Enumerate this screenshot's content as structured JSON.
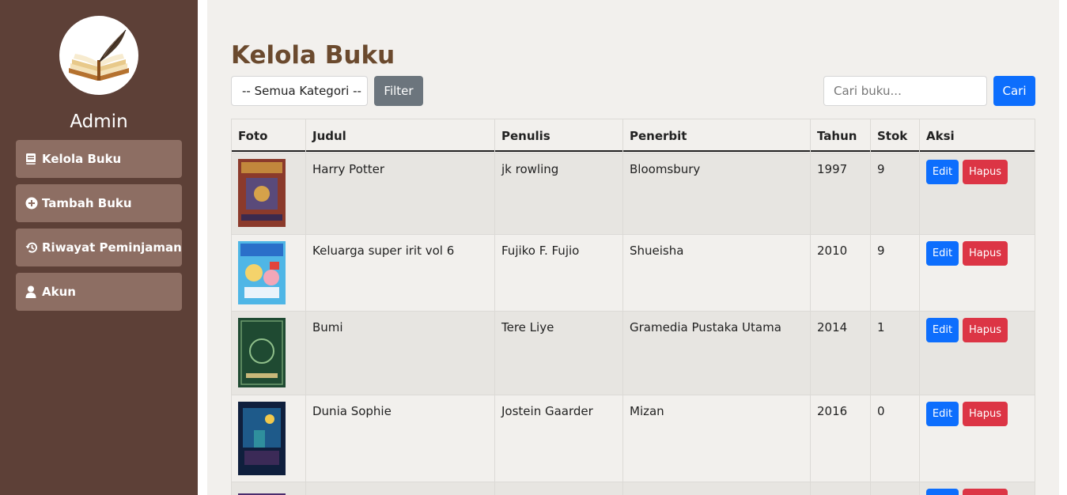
{
  "sidebar": {
    "username": "Admin",
    "items": [
      {
        "label": "Kelola Buku",
        "icon": "book-icon"
      },
      {
        "label": "Tambah Buku",
        "icon": "plus-circle-icon"
      },
      {
        "label": "Riwayat Peminjaman",
        "icon": "history-icon"
      },
      {
        "label": "Akun",
        "icon": "user-icon"
      }
    ]
  },
  "main": {
    "title": "Kelola Buku",
    "category_select": "-- Semua Kategori --",
    "filter_label": "Filter",
    "search_placeholder": "Cari buku...",
    "search_button": "Cari"
  },
  "table": {
    "headers": [
      "Foto",
      "Judul",
      "Penulis",
      "Penerbit",
      "Tahun",
      "Stok",
      "Aksi"
    ],
    "rows": [
      {
        "judul": "Harry Potter",
        "penulis": "jk rowling",
        "penerbit": "Bloomsbury",
        "tahun": "1997",
        "stok": "9"
      },
      {
        "judul": "Keluarga super irit vol 6",
        "penulis": "Fujiko F. Fujio",
        "penerbit": "Shueisha",
        "tahun": "2010",
        "stok": "9"
      },
      {
        "judul": "Bumi",
        "penulis": "Tere Liye",
        "penerbit": "Gramedia Pustaka Utama",
        "tahun": "2014",
        "stok": "1"
      },
      {
        "judul": "Dunia Sophie",
        "penulis": "Jostein Gaarder",
        "penerbit": "Mizan",
        "tahun": "2016",
        "stok": "0"
      }
    ],
    "edit_label": "Edit",
    "hapus_label": "Hapus"
  },
  "colors": {
    "sidebar": "#5d4037",
    "nav_item": "#8d6e63",
    "main_bg": "#f2f0ed",
    "title": "#6b4a2e",
    "primary": "#0d6efd",
    "danger": "#dc3545",
    "secondary": "#6c757d"
  }
}
